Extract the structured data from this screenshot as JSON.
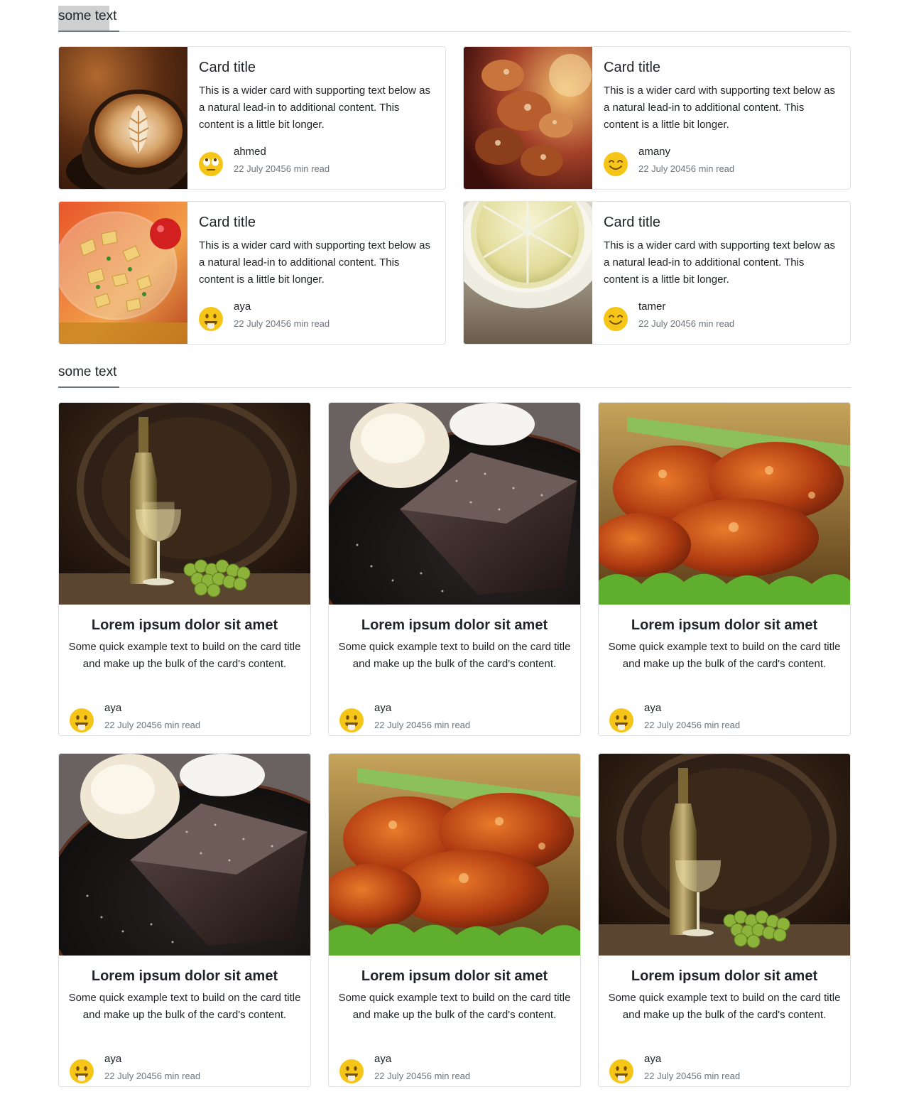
{
  "sections": [
    {
      "heading": "some text"
    },
    {
      "heading": "some text"
    }
  ],
  "horizontal_cards": [
    {
      "title": "Card title",
      "text": "This is a wider card with supporting text below as a natural lead-in to additional content. This content is a little bit longer.",
      "author": "ahmed",
      "meta": "22 July 20456 min read",
      "image": "latte-image",
      "avatar": "rolling-eyes-emoji-icon"
    },
    {
      "title": "Card title",
      "text": "This is a wider card with supporting text below as a natural lead-in to additional content. This content is a little bit longer.",
      "author": "amany",
      "meta": "22 July 20456 min read",
      "image": "pastry-image",
      "avatar": "smiling-emoji-icon"
    },
    {
      "title": "Card title",
      "text": "This is a wider card with supporting text below as a natural lead-in to additional content. This content is a little bit longer.",
      "author": "aya",
      "meta": "22 July 20456 min read",
      "image": "pasta-salad-image",
      "avatar": "tongue-out-emoji-icon"
    },
    {
      "title": "Card title",
      "text": "This is a wider card with supporting text below as a natural lead-in to additional content. This content is a little bit longer.",
      "author": "tamer",
      "meta": "22 July 20456 min read",
      "image": "lemon-slice-image",
      "avatar": "smiling-emoji-icon"
    }
  ],
  "vertical_cards": [
    {
      "title": "Lorem ipsum dolor sit amet",
      "text": "Some quick example text to build on the card title and make up the bulk of the card's content.",
      "author": "aya",
      "meta": "22 July 20456 min read",
      "image": "wine-image"
    },
    {
      "title": "Lorem ipsum dolor sit amet",
      "text": "Some quick example text to build on the card title and make up the bulk of the card's content.",
      "author": "aya",
      "meta": "22 July 20456 min read",
      "image": "brownie-image"
    },
    {
      "title": "Lorem ipsum dolor sit amet",
      "text": "Some quick example text to build on the card title and make up the bulk of the card's content.",
      "author": "aya",
      "meta": "22 July 20456 min read",
      "image": "chicken-wings-image"
    },
    {
      "title": "Lorem ipsum dolor sit amet",
      "text": "Some quick example text to build on the card title and make up the bulk of the card's content.",
      "author": "aya",
      "meta": "22 July 20456 min read",
      "image": "brownie-image"
    },
    {
      "title": "Lorem ipsum dolor sit amet",
      "text": "Some quick example text to build on the card title and make up the bulk of the card's content.",
      "author": "aya",
      "meta": "22 July 20456 min read",
      "image": "chicken-wings-image"
    },
    {
      "title": "Lorem ipsum dolor sit amet",
      "text": "Some quick example text to build on the card title and make up the bulk of the card's content.",
      "author": "aya",
      "meta": "22 July 20456 min read",
      "image": "wine-image"
    }
  ],
  "colors": {
    "emoji": "#f5c518",
    "border": "#dfe1e4",
    "muted": "#6c757d",
    "text": "#212529"
  }
}
